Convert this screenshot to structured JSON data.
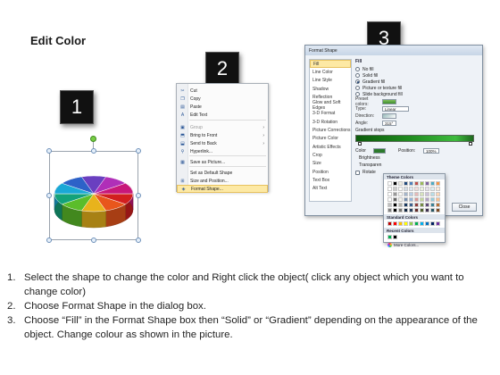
{
  "page_title": "Edit Color",
  "badges": [
    "1",
    "2",
    "3"
  ],
  "context_menu": {
    "items": [
      {
        "icon": "cut-icon",
        "label": "Cut",
        "disabled": false
      },
      {
        "icon": "copy-icon",
        "label": "Copy",
        "disabled": false
      },
      {
        "icon": "paste-icon",
        "label": "Paste",
        "disabled": false
      },
      {
        "icon": "edit-text-icon",
        "label": "Edit Text",
        "disabled": false
      },
      {
        "icon": "group-icon",
        "label": "Group",
        "disabled": true,
        "submenu": true
      },
      {
        "icon": "bring-front-icon",
        "label": "Bring to Front",
        "disabled": false,
        "submenu": true
      },
      {
        "icon": "send-back-icon",
        "label": "Send to Back",
        "disabled": false,
        "submenu": true
      },
      {
        "icon": "hyperlink-icon",
        "label": "Hyperlink...",
        "disabled": false
      },
      {
        "icon": "save-picture-icon",
        "label": "Save as Picture...",
        "disabled": false
      },
      {
        "icon": "set-default-icon",
        "label": "Set as Default Shape",
        "disabled": false
      },
      {
        "icon": "size-position-icon",
        "label": "Size and Position...",
        "disabled": false
      },
      {
        "icon": "format-shape-icon",
        "label": "Format Shape...",
        "disabled": false,
        "highlighted": true
      }
    ]
  },
  "dialog": {
    "title": "Format Shape",
    "sidebar": [
      "Fill",
      "Line Color",
      "Line Style",
      "Shadow",
      "Reflection",
      "Glow and Soft Edges",
      "3-D Format",
      "3-D Rotation",
      "Picture Corrections",
      "Picture Color",
      "Artistic Effects",
      "Crop",
      "Size",
      "Position",
      "Text Box",
      "Alt Text"
    ],
    "selected_sidebar": "Fill",
    "panel_heading": "Fill",
    "fill_options": [
      "No fill",
      "Solid fill",
      "Gradient fill",
      "Picture or texture fill",
      "Slide background fill"
    ],
    "selected_fill": "Gradient fill",
    "preset_colors_label": "Preset colors:",
    "type_label": "Type:",
    "type_value": "Linear",
    "direction_label": "Direction:",
    "angle_label": "Angle:",
    "angle_value": "315°",
    "gradient_stops_label": "Gradient stops",
    "color_label": "Color",
    "position_label": "Position:",
    "position_value": "100%",
    "brightness_label": "Brightness",
    "transparency_label": "Transparen",
    "rotate_label": "Rotate",
    "close_button": "Close"
  },
  "color_popup": {
    "theme_label": "Theme Colors",
    "standard_label": "Standard Colors",
    "recent_label": "Recent Colors",
    "more_label": "More Colors...",
    "theme_top": [
      "#ffffff",
      "#000000",
      "#eeece1",
      "#1f497d",
      "#4f81bd",
      "#c0504d",
      "#9bbb59",
      "#8064a2",
      "#4bacc6",
      "#f79646"
    ],
    "standard": [
      "#c00000",
      "#ff0000",
      "#ffc000",
      "#ffff00",
      "#92d050",
      "#00b050",
      "#00b0f0",
      "#0070c0",
      "#002060",
      "#7030a0"
    ],
    "recent": [
      "#00b050",
      "#000000"
    ]
  },
  "pie_colors": [
    "#d21f1f",
    "#e8561c",
    "#e8b31c",
    "#5bbd2a",
    "#13a27a",
    "#1aa8d6",
    "#2d62c8",
    "#6a3fc0",
    "#b02fb8",
    "#c8187a"
  ],
  "instructions": [
    {
      "num": "1.",
      "text": "Select the shape to change the color and Right click the object( click any object which you want to change color)"
    },
    {
      "num": "2.",
      "text": "Choose Format Shape in the dialog box."
    },
    {
      "num": "3.",
      "text": "Choose “Fill” in the Format Shape box then “Solid” or “Gradient” depending on the appearance of the object. Change colour as shown in the picture."
    }
  ]
}
